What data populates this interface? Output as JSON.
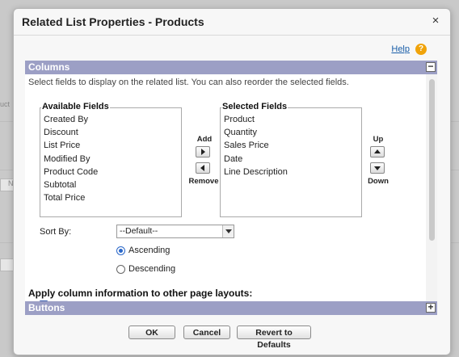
{
  "dialog": {
    "title": "Related List Properties - Products",
    "close_glyph": "×",
    "help_label": "Help",
    "help_icon_glyph": "?"
  },
  "background": {
    "edge_labels": [
      "uct",
      "N"
    ]
  },
  "sections": {
    "columns": {
      "label": "Columns",
      "toggle": "−"
    },
    "buttons": {
      "label": "Buttons",
      "toggle": "+"
    }
  },
  "columns": {
    "instructions": "Select fields to display on the related list. You can also reorder the selected fields.",
    "available": {
      "title": "Available Fields",
      "items": [
        "Created By",
        "Discount",
        "List Price",
        "Modified By",
        "Product Code",
        "Subtotal",
        "Total Price"
      ]
    },
    "selected": {
      "title": "Selected Fields",
      "items": [
        "Product",
        "Quantity",
        "Sales Price",
        "Date",
        "Line Description"
      ]
    },
    "add_label": "Add",
    "remove_label": "Remove",
    "up_label": "Up",
    "down_label": "Down",
    "sort_by_label": "Sort By:",
    "sort_by_value": "--Default--",
    "ascending_label": "Ascending",
    "descending_label": "Descending",
    "sort_order_selected": "ascending",
    "apply_heading": "Apply column information to other page layouts:"
  },
  "footer": {
    "ok_label": "OK",
    "cancel_label": "Cancel",
    "revert_label": "Revert to Defaults"
  },
  "colors": {
    "section_bar": "#9c9fc5",
    "link": "#1a5ea8",
    "help_icon": "#f0a30a",
    "radio_selected": "#2a67c9"
  }
}
